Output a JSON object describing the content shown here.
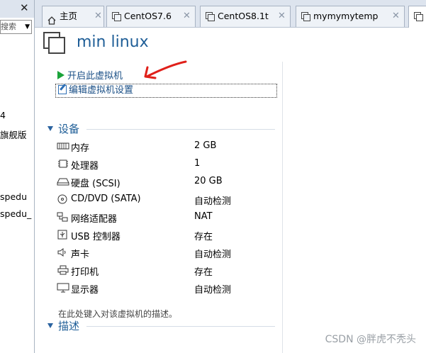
{
  "left_pane": {
    "search_placeholder": "搜索",
    "items": [
      "4",
      "旗舰版",
      "spedu",
      "spedu_"
    ]
  },
  "tabs": [
    {
      "label": "主页",
      "icon": "home-icon"
    },
    {
      "label": "CentOS7.6",
      "icon": "vm-icon"
    },
    {
      "label": "CentOS8.1t",
      "icon": "vm-icon"
    },
    {
      "label": "mymymytemp",
      "icon": "vm-icon"
    }
  ],
  "vm": {
    "title": "min linux",
    "actions": {
      "power_on": "开启此虚拟机",
      "edit_settings": "编辑虚拟机设置"
    }
  },
  "devices_section": {
    "title": "设备",
    "rows": [
      {
        "name": "内存",
        "value": "2 GB",
        "icon": "memory-icon"
      },
      {
        "name": "处理器",
        "value": "1",
        "icon": "cpu-icon"
      },
      {
        "name": "硬盘 (SCSI)",
        "value": "20 GB",
        "icon": "hard-disk-icon"
      },
      {
        "name": "CD/DVD (SATA)",
        "value": "自动检测",
        "icon": "cd-dvd-icon"
      },
      {
        "name": "网络适配器",
        "value": "NAT",
        "icon": "network-adapter-icon"
      },
      {
        "name": "USB 控制器",
        "value": "存在",
        "icon": "usb-icon"
      },
      {
        "name": "声卡",
        "value": "自动检测",
        "icon": "sound-card-icon"
      },
      {
        "name": "打印机",
        "value": "存在",
        "icon": "printer-icon"
      },
      {
        "name": "显示器",
        "value": "自动检测",
        "icon": "display-icon"
      }
    ]
  },
  "description_section": {
    "title": "描述",
    "placeholder": "在此处键入对该虚拟机的描述。"
  },
  "watermark": "CSDN @胖虎不秃头",
  "colors": {
    "accent": "#1f5e97",
    "play_green": "#1aa33a",
    "annotation_red": "#e0201a"
  }
}
